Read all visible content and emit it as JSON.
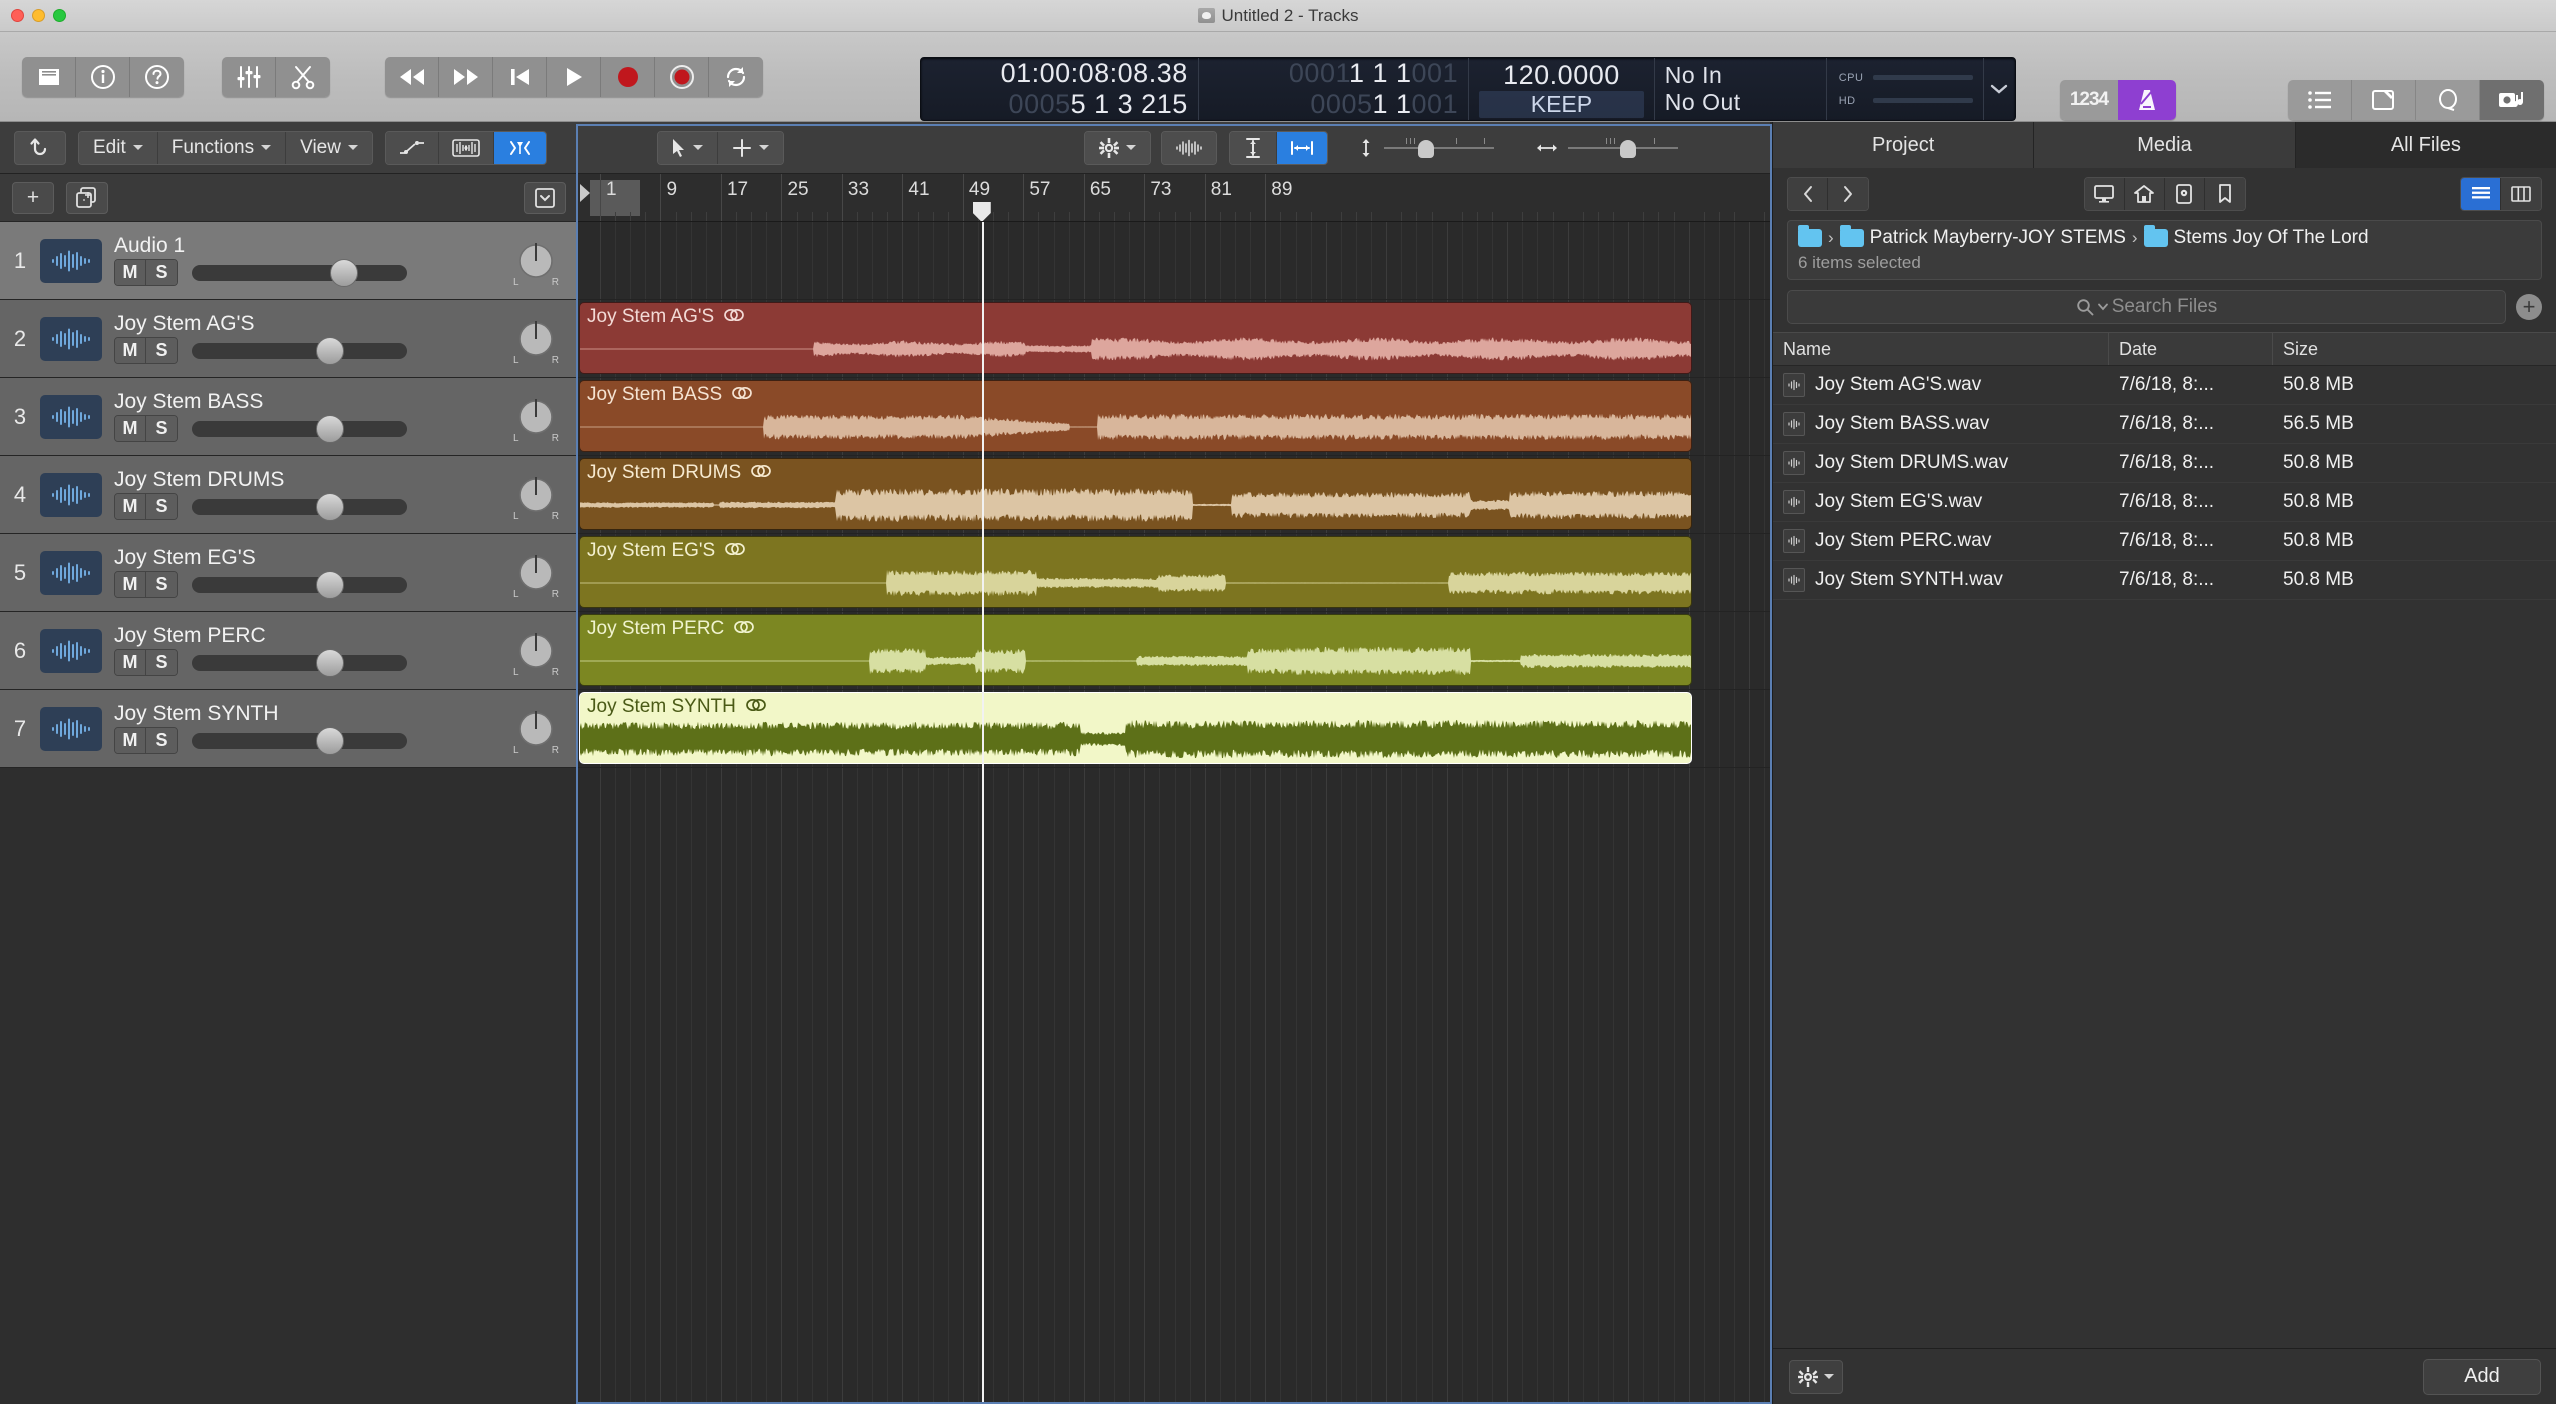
{
  "window": {
    "title": "Untitled 2 - Tracks",
    "title_icon": "project-disc-icon"
  },
  "toolbar": {
    "left_buttons": [
      {
        "name": "library-icon",
        "label": ""
      },
      {
        "name": "inspector-info-icon",
        "label": ""
      },
      {
        "name": "quick-help-icon",
        "label": ""
      }
    ],
    "second_group": [
      {
        "name": "mixer-faders-icon",
        "label": ""
      },
      {
        "name": "smart-controls-scissors-icon",
        "label": ""
      }
    ],
    "transport": [
      {
        "name": "rewind-icon",
        "label": ""
      },
      {
        "name": "forward-icon",
        "label": ""
      },
      {
        "name": "go-to-beginning-icon",
        "label": ""
      },
      {
        "name": "play-icon",
        "label": ""
      },
      {
        "name": "record-icon",
        "label": ""
      },
      {
        "name": "record-enable-icon",
        "label": ""
      },
      {
        "name": "cycle-icon",
        "label": ""
      }
    ],
    "mode_buttons": {
      "count_in_label": "1234",
      "metronome_name": "metronome-icon",
      "metronome_color": "#8e3fd1"
    },
    "right_buttons": [
      {
        "name": "list-editors-icon"
      },
      {
        "name": "notes-icon"
      },
      {
        "name": "loops-icon"
      },
      {
        "name": "media-browser-icon"
      }
    ]
  },
  "lcd": {
    "timecode": "01:00:08:08.38",
    "position_secondary": "0005",
    "position_bars": "5  1  3  215",
    "left_locator_dim": "0001",
    "left_locator": "1   1   1",
    "left_locator_tail": "001",
    "right_locator_dim": "0005",
    "right_locator": "1   1",
    "right_locator_tail": "001",
    "tempo": "120.0000",
    "sync_mode": "KEEP",
    "input": "No In",
    "output": "No Out",
    "cpu_label": "CPU",
    "hd_label": "HD"
  },
  "local_toolbar": {
    "undo_icon": "undo-arrow-icon",
    "menus": [
      {
        "label": "Edit",
        "name": "menu-edit"
      },
      {
        "label": "Functions",
        "name": "menu-functions"
      },
      {
        "label": "View",
        "name": "menu-view"
      }
    ],
    "right_icons": [
      {
        "name": "automation-icon"
      },
      {
        "name": "flex-time-icon"
      },
      {
        "name": "snap-to-icon",
        "active": true
      }
    ],
    "tools": [
      {
        "name": "pointer-tool"
      },
      {
        "name": "marquee-tool"
      }
    ],
    "view_icons": [
      {
        "name": "snap-gear-icon"
      },
      {
        "name": "waveform-icon"
      },
      {
        "name": "track-height-fit-icon"
      },
      {
        "name": "horizontal-fit-icon",
        "active": true
      }
    ],
    "zoom_vertical_name": "vertical-zoom-slider",
    "zoom_horizontal_name": "horizontal-zoom-slider"
  },
  "track_header_bar": {
    "add_track_label": "+",
    "duplicate_track_name": "duplicate-track-icon",
    "track_config_name": "track-header-config-icon"
  },
  "ruler": {
    "bar_numbers": [
      "1",
      "9",
      "17",
      "25",
      "33",
      "41",
      "49",
      "57",
      "65",
      "73",
      "81",
      "89"
    ]
  },
  "tracks": [
    {
      "num": "1",
      "name": "Audio 1",
      "mute": "M",
      "solo": "S",
      "volume_pct": 69,
      "selected": true
    },
    {
      "num": "2",
      "name": "Joy Stem AG'S",
      "mute": "M",
      "solo": "S",
      "volume_pct": 62,
      "selected": false
    },
    {
      "num": "3",
      "name": "Joy Stem BASS",
      "mute": "M",
      "solo": "S",
      "volume_pct": 62,
      "selected": false
    },
    {
      "num": "4",
      "name": "Joy Stem DRUMS",
      "mute": "M",
      "solo": "S",
      "volume_pct": 62,
      "selected": false
    },
    {
      "num": "5",
      "name": "Joy Stem EG'S",
      "mute": "M",
      "solo": "S",
      "volume_pct": 62,
      "selected": false
    },
    {
      "num": "6",
      "name": "Joy Stem PERC",
      "mute": "M",
      "solo": "S",
      "volume_pct": 62,
      "selected": false
    },
    {
      "num": "7",
      "name": "Joy Stem SYNTH",
      "mute": "M",
      "solo": "S",
      "volume_pct": 62,
      "selected": false
    }
  ],
  "regions": [
    {
      "lane": 1,
      "name": "Joy Stem AG'S",
      "fill": "#8c3a35",
      "text": "#f3dad6",
      "wave": "#dda69d",
      "selected": false
    },
    {
      "lane": 2,
      "name": "Joy Stem BASS",
      "fill": "#8a4a28",
      "text": "#f5e3d2",
      "wave": "#d8b69b",
      "selected": false
    },
    {
      "lane": 3,
      "name": "Joy Stem DRUMS",
      "fill": "#7a5320",
      "text": "#f7ead0",
      "wave": "#dcc5a4",
      "selected": false
    },
    {
      "lane": 4,
      "name": "Joy Stem EG'S",
      "fill": "#7d7520",
      "text": "#f3f0cf",
      "wave": "#d8d49b",
      "selected": false
    },
    {
      "lane": 5,
      "name": "Joy Stem PERC",
      "fill": "#7c8722",
      "text": "#f0f3cf",
      "wave": "#d7dfa2",
      "selected": false
    },
    {
      "lane": 6,
      "name": "Joy Stem SYNTH",
      "fill": "#f2f7c8",
      "text": "#4a5a16",
      "wave": "#5d7018",
      "selected": true
    }
  ],
  "browser": {
    "tabs": [
      {
        "label": "Project",
        "name": "tab-project",
        "active": false
      },
      {
        "label": "Media",
        "name": "tab-media",
        "active": false
      },
      {
        "label": "All Files",
        "name": "tab-all-files",
        "active": true
      }
    ],
    "nav": {
      "back_icon": "chevron-left-icon",
      "forward_icon": "chevron-right-icon",
      "shortcuts": [
        {
          "name": "computer-icon"
        },
        {
          "name": "home-icon"
        },
        {
          "name": "project-folder-icon"
        },
        {
          "name": "bookmark-icon"
        }
      ],
      "view_list_name": "list-view-icon",
      "view_column_name": "column-view-icon"
    },
    "path": [
      "Patrick Mayberry-JOY STEMS",
      "Stems Joy Of The Lord"
    ],
    "selection_status": "6 items selected",
    "search_placeholder": "Search Files",
    "add_item_icon": "add-path-icon",
    "columns": [
      "Name",
      "Date",
      "Size"
    ],
    "files": [
      {
        "name": "Joy Stem AG'S.wav",
        "date": "7/6/18, 8:...",
        "size": "50.8 MB"
      },
      {
        "name": "Joy Stem BASS.wav",
        "date": "7/6/18, 8:...",
        "size": "56.5 MB"
      },
      {
        "name": "Joy Stem DRUMS.wav",
        "date": "7/6/18, 8:...",
        "size": "50.8 MB"
      },
      {
        "name": "Joy Stem EG'S.wav",
        "date": "7/6/18, 8:...",
        "size": "50.8 MB"
      },
      {
        "name": "Joy Stem PERC.wav",
        "date": "7/6/18, 8:...",
        "size": "50.8 MB"
      },
      {
        "name": "Joy Stem SYNTH.wav",
        "date": "7/6/18, 8:...",
        "size": "50.8 MB"
      }
    ],
    "footer": {
      "gear_name": "browser-action-gear-icon",
      "add_label": "Add"
    }
  },
  "colors": {
    "accent_blue": "#2a7fe0",
    "metronome_purple": "#8e3fd1",
    "selection_border": "#5b7fb3"
  }
}
